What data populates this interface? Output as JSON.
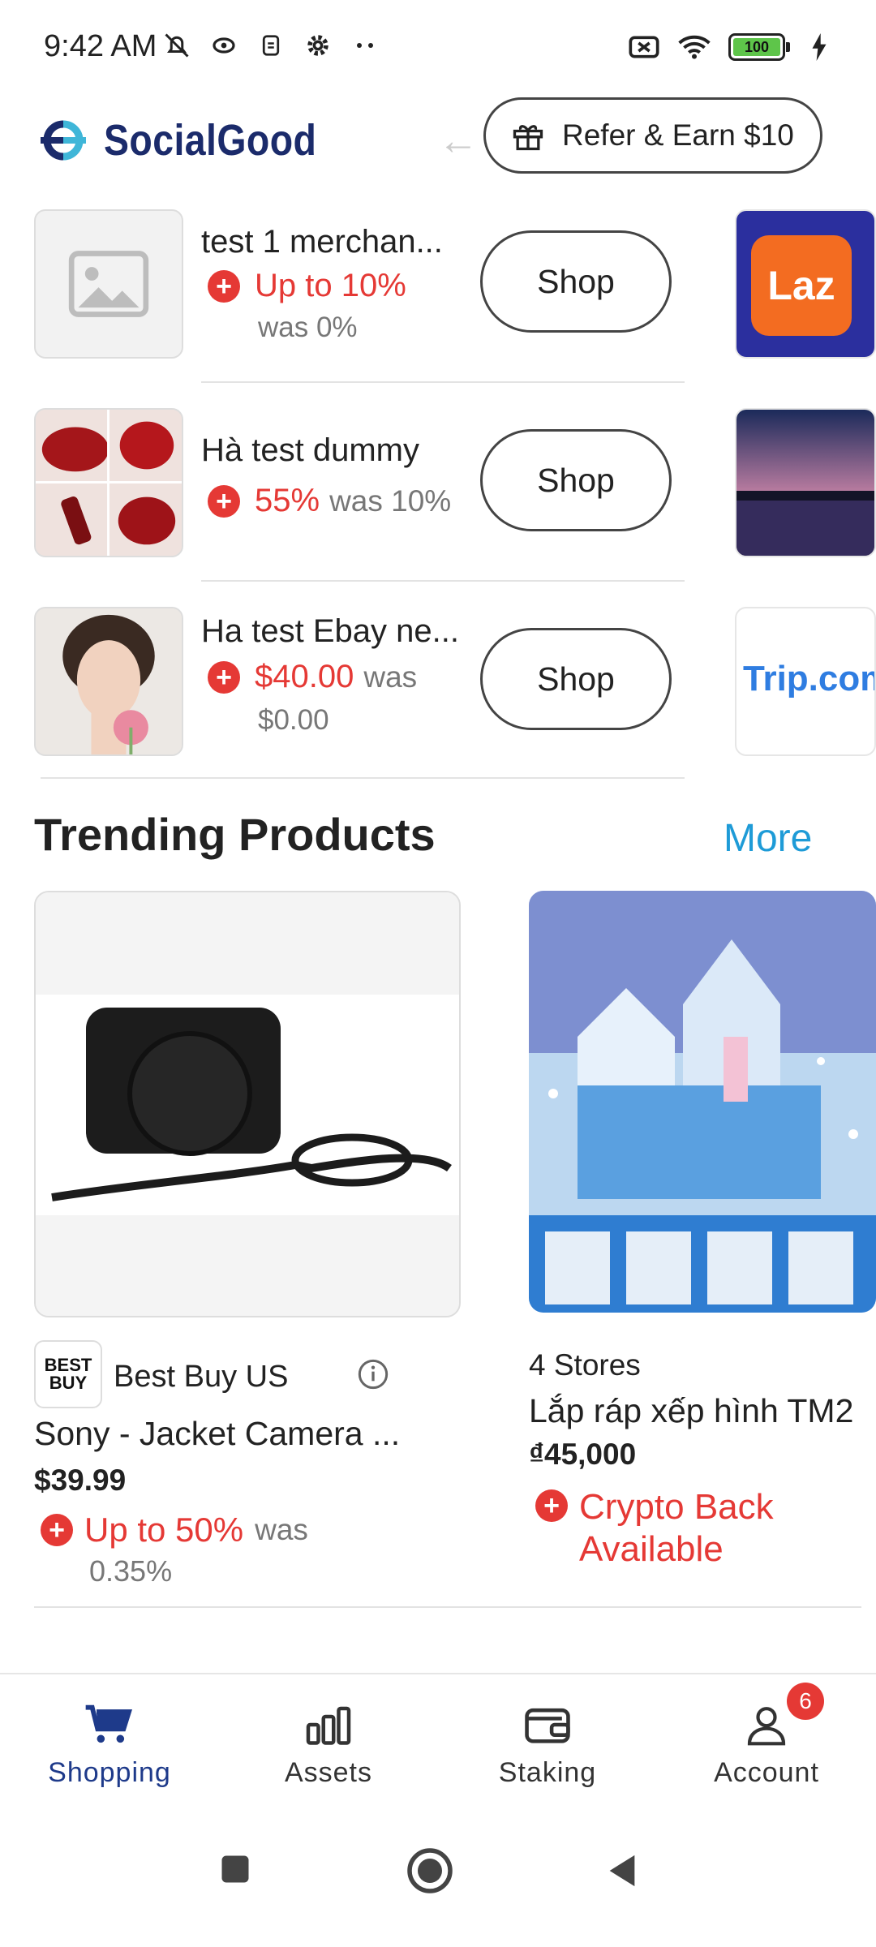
{
  "status_bar": {
    "time": "9:42 AM",
    "battery": "100",
    "icons_left": [
      "mute-bell-icon",
      "vpn-icon",
      "sim-icon",
      "settings-icon",
      "more-dots-icon"
    ],
    "icons_right": [
      "sim-off-icon",
      "wifi-icon",
      "battery-icon",
      "charging-icon"
    ]
  },
  "header": {
    "logo_text": "SocialGood",
    "refer_label": "Refer & Earn $10"
  },
  "merchants": [
    {
      "name": "test 1 merchan...",
      "rate": "Up to 10%",
      "was": "was 0%",
      "shop_label": "Shop"
    },
    {
      "name": "Hà test dummy",
      "rate": "55%",
      "was": "was 10%",
      "shop_label": "Shop"
    },
    {
      "name": "Ha test Ebay ne...",
      "rate": "$40.00",
      "was": "was",
      "was_value": "$0.00",
      "shop_label": "Shop"
    }
  ],
  "side_cards": {
    "laz_label": "Laz",
    "trip_label": "Trip.com"
  },
  "trending": {
    "title": "Trending Products",
    "more_label": "More",
    "products": [
      {
        "store_logo_text": "BEST BUY",
        "store": "Best Buy US",
        "name": "Sony - Jacket Camera ...",
        "price": "$39.99",
        "rate": "Up to 50%",
        "was": "was",
        "was_value": "0.35%"
      },
      {
        "stores": "4 Stores",
        "name": "Lắp ráp xếp hình TM2",
        "price": "₫45,000",
        "rate": "Crypto Back Available"
      }
    ]
  },
  "bottom_nav": [
    {
      "label": "Shopping",
      "icon": "cart-icon",
      "active": true
    },
    {
      "label": "Assets",
      "icon": "bar-chart-icon"
    },
    {
      "label": "Staking",
      "icon": "wallet-icon"
    },
    {
      "label": "Account",
      "icon": "person-icon",
      "badge": "6"
    }
  ],
  "colors": {
    "accent_red": "#e53935",
    "brand_navy": "#1b2b6b",
    "link_blue": "#1e9bd7"
  }
}
